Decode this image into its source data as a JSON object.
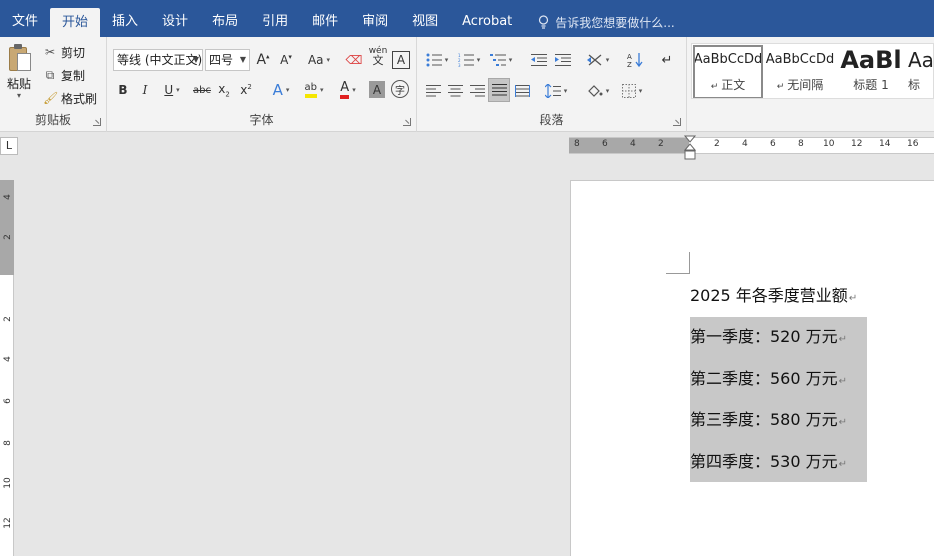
{
  "menu": {
    "tabs": [
      "文件",
      "开始",
      "插入",
      "设计",
      "布局",
      "引用",
      "邮件",
      "审阅",
      "视图",
      "Acrobat"
    ],
    "active_tab": "开始",
    "tell_me": "告诉我您想要做什么..."
  },
  "clipboard": {
    "paste": "粘贴",
    "cut": "剪切",
    "copy": "复制",
    "format_painter": "格式刷",
    "label": "剪贴板"
  },
  "font": {
    "name": "等线 (中文正文)",
    "size": "四号",
    "change_case": "Aa",
    "phonetic": "wén",
    "label": "字体",
    "font_color": "#e02020",
    "highlight_color": "#f5e600"
  },
  "paragraph": {
    "label": "段落"
  },
  "styles": {
    "items": [
      {
        "sample": "AaBbCcDd",
        "name": "正文"
      },
      {
        "sample": "AaBbCcDd",
        "name": "无间隔"
      },
      {
        "sample": "AaBl",
        "name": "标题 1"
      },
      {
        "sample": "Aa",
        "name": "标"
      }
    ]
  },
  "ruler": {
    "corner": "L",
    "h_labels": [
      "8",
      "6",
      "4",
      "2",
      "2",
      "4",
      "6",
      "8",
      "10",
      "12",
      "14",
      "16"
    ],
    "v_labels": [
      "4",
      "2",
      "2",
      "4",
      "6",
      "8",
      "10",
      "12"
    ]
  },
  "document": {
    "title": "2025 年各季度营业额",
    "lines": [
      "第一季度：520 万元",
      "第二季度：560 万元",
      "第三季度：580 万元",
      "第四季度：530 万元"
    ],
    "paragraph_mark": "↵"
  },
  "colors": {
    "accent": "#2b579a",
    "ribbon": "#f3f3f3",
    "selection": "#c8c8c8"
  }
}
